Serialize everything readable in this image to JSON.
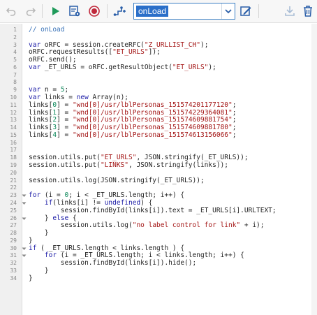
{
  "toolbar": {
    "event_select": {
      "value": "onLoad"
    },
    "icons": [
      "undo-icon",
      "redo-icon",
      "run-icon",
      "settings-icon",
      "record-icon",
      "add-script-icon",
      "edit-icon",
      "download-icon",
      "delete-icon"
    ],
    "accent": "#2a6fc9"
  },
  "editor": {
    "lines": [
      {
        "n": "1",
        "text": "// onLoad",
        "fold": false
      },
      {
        "n": "2",
        "text": "",
        "fold": false
      },
      {
        "n": "3",
        "text": "var oRFC = session.createRFC(\"Z_URLLIST_CH\");",
        "fold": false
      },
      {
        "n": "4",
        "text": "oRFC.requestResults([\"ET_URLS\"]);",
        "fold": false
      },
      {
        "n": "5",
        "text": "oRFC.send();",
        "fold": false
      },
      {
        "n": "6",
        "text": "var _ET_URLS = oRFC.getResultObject(\"ET_URLS\");",
        "fold": false
      },
      {
        "n": "7",
        "text": "",
        "fold": false
      },
      {
        "n": "8",
        "text": "",
        "fold": false
      },
      {
        "n": "9",
        "text": "var n = 5;",
        "fold": false
      },
      {
        "n": "10",
        "text": "var links = new Array(n);",
        "fold": false
      },
      {
        "n": "11",
        "text": "links[0] = \"wnd[0]/usr/lblPersonas_151574201177120\";",
        "fold": false
      },
      {
        "n": "12",
        "text": "links[1] = \"wnd[0]/usr/lblPersonas_151574229364081\";",
        "fold": false
      },
      {
        "n": "13",
        "text": "links[2] = \"wnd[0]/usr/lblPersonas_151574609881754\";",
        "fold": false
      },
      {
        "n": "14",
        "text": "links[3] = \"wnd[0]/usr/lblPersonas_151574609881780\";",
        "fold": false
      },
      {
        "n": "15",
        "text": "links[4] = \"wnd[0]/usr/lblPersonas_151574613156066\";",
        "fold": false
      },
      {
        "n": "16",
        "text": "",
        "fold": false
      },
      {
        "n": "17",
        "text": "",
        "fold": false
      },
      {
        "n": "18",
        "text": "session.utils.put(\"ET_URLS\", JSON.stringify(_ET_URLS));",
        "fold": false
      },
      {
        "n": "19",
        "text": "session.utils.put(\"LINKS\", JSON.stringify(links));",
        "fold": false
      },
      {
        "n": "20",
        "text": "",
        "fold": false
      },
      {
        "n": "21",
        "text": "session.utils.log(JSON.stringify(_ET_URLS));",
        "fold": false
      },
      {
        "n": "22",
        "text": "",
        "fold": false
      },
      {
        "n": "23",
        "text": "for (i = 0; i < _ET_URLS.length; i++) {",
        "fold": true
      },
      {
        "n": "24",
        "text": "    if(links[i] != undefined) {",
        "fold": true
      },
      {
        "n": "25",
        "text": "        session.findById(links[i]).text = _ET_URLS[i].URLTEXT;",
        "fold": false
      },
      {
        "n": "26",
        "text": "    } else {",
        "fold": true
      },
      {
        "n": "27",
        "text": "        session.utils.log(\"no label control for link\" + i);",
        "fold": false
      },
      {
        "n": "28",
        "text": "    }",
        "fold": false
      },
      {
        "n": "29",
        "text": "}",
        "fold": false
      },
      {
        "n": "30",
        "text": "if ( _ET_URLS.length < links.length ) {",
        "fold": true
      },
      {
        "n": "31",
        "text": "    for (i = _ET_URLS.length; i < links.length; i++) {",
        "fold": true
      },
      {
        "n": "32",
        "text": "        session.findById(links[i]).hide();",
        "fold": false
      },
      {
        "n": "33",
        "text": "    }",
        "fold": false
      },
      {
        "n": "34",
        "text": "}",
        "fold": false
      }
    ],
    "colors": {
      "keyword": "#1a1aa6",
      "string": "#a31515",
      "comment": "#3a73b8",
      "number": "#098658",
      "text": "#222222"
    }
  }
}
